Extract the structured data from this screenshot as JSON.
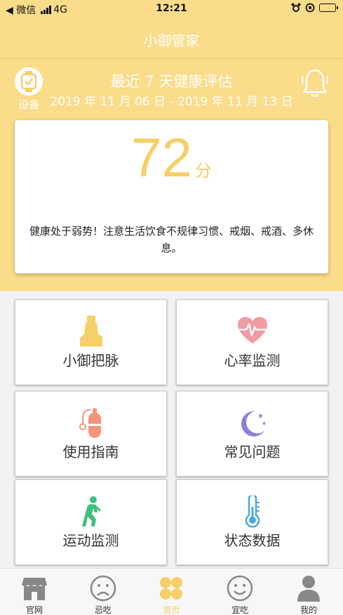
{
  "status_bar": {
    "back_app": "◀ 微信",
    "network": "4G",
    "time": "12:21"
  },
  "nav": {
    "title": "小御管家"
  },
  "header": {
    "device_label": "设备",
    "eval_title": "最近 7 天健康评估",
    "date_range": "2019 年 11 月 06 日 - 2019 年 11 月 13 日"
  },
  "score_card": {
    "score": "72",
    "unit": "分",
    "advice": "健康处于弱势！注意生活饮食不规律习惯、戒烟、戒酒、多休息。"
  },
  "tiles": [
    {
      "label": "小御把脉",
      "icon": "pulse-hand-icon"
    },
    {
      "label": "心率监测",
      "icon": "heart-rate-icon"
    },
    {
      "label": "使用指南",
      "icon": "guide-device-icon"
    },
    {
      "label": "常见问题",
      "icon": "moon-stars-icon"
    },
    {
      "label": "运动监测",
      "icon": "walking-person-icon"
    },
    {
      "label": "状态数据",
      "icon": "thermometer-icon"
    }
  ],
  "tabs": [
    {
      "label": "官网",
      "icon": "store-icon"
    },
    {
      "label": "忌吃",
      "icon": "sad-face-icon"
    },
    {
      "label": "首页",
      "icon": "clover-icon",
      "active": true
    },
    {
      "label": "宜吃",
      "icon": "happy-face-icon"
    },
    {
      "label": "我的",
      "icon": "person-icon"
    }
  ],
  "colors": {
    "theme": "#fbdc8a",
    "score": "#f5cf6a",
    "heart": "#f29ba4",
    "guide": "#f5967a",
    "moon": "#8a82d8",
    "walker": "#3fbf7f",
    "thermo": "#4da6e0"
  }
}
